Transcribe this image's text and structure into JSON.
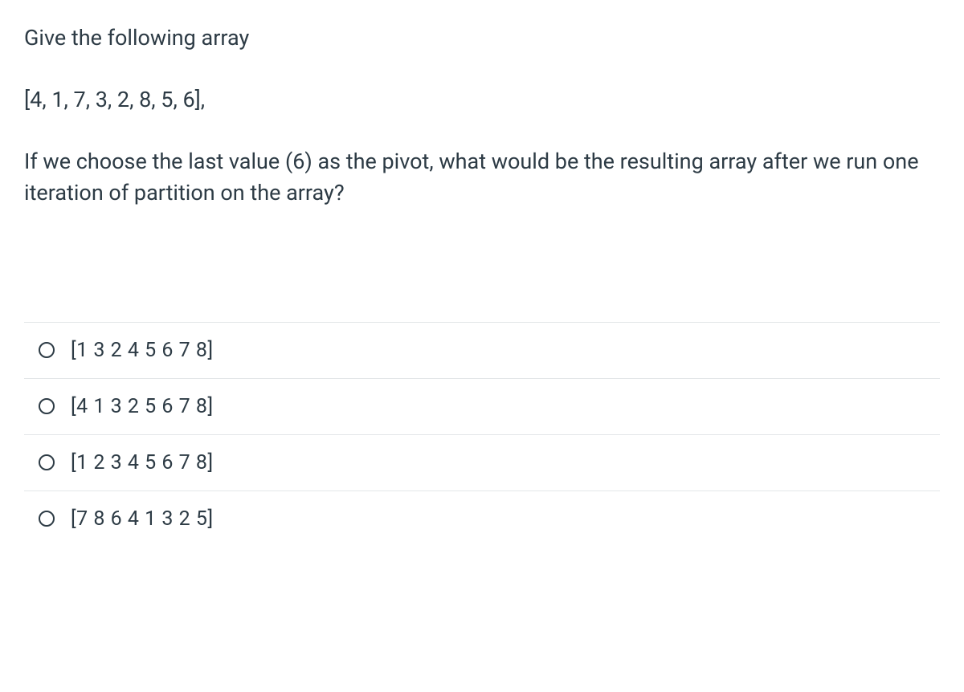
{
  "question": {
    "line1": "Give the following array",
    "line2": "[4, 1, 7,  3,  2, 8, 5, 6],",
    "line3": "If we choose the last value (6) as the pivot, what would be the resulting array after we run one iteration of partition on the array?"
  },
  "options": [
    {
      "label": "[1 3 2 4 5 6 7 8]"
    },
    {
      "label": "[4 1 3 2 5 6 7 8]"
    },
    {
      "label": "[1 2 3 4 5 6 7 8]"
    },
    {
      "label": "[7 8 6 4 1 3 2 5]"
    }
  ]
}
